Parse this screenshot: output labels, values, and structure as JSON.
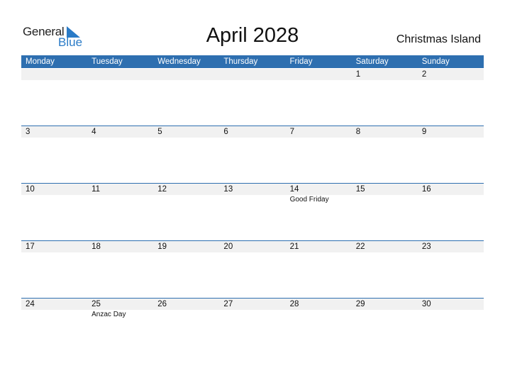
{
  "logo": {
    "text_general": "General",
    "text_blue": "Blue",
    "accent_color": "#2a7bc7"
  },
  "title": "April 2028",
  "country": "Christmas Island",
  "header_color": "#2e6fb0",
  "weekdays": [
    "Monday",
    "Tuesday",
    "Wednesday",
    "Thursday",
    "Friday",
    "Saturday",
    "Sunday"
  ],
  "weeks": [
    [
      {
        "day": ""
      },
      {
        "day": ""
      },
      {
        "day": ""
      },
      {
        "day": ""
      },
      {
        "day": ""
      },
      {
        "day": "1"
      },
      {
        "day": "2"
      }
    ],
    [
      {
        "day": "3"
      },
      {
        "day": "4"
      },
      {
        "day": "5"
      },
      {
        "day": "6"
      },
      {
        "day": "7"
      },
      {
        "day": "8"
      },
      {
        "day": "9"
      }
    ],
    [
      {
        "day": "10"
      },
      {
        "day": "11"
      },
      {
        "day": "12"
      },
      {
        "day": "13"
      },
      {
        "day": "14",
        "event": "Good Friday"
      },
      {
        "day": "15"
      },
      {
        "day": "16"
      }
    ],
    [
      {
        "day": "17"
      },
      {
        "day": "18"
      },
      {
        "day": "19"
      },
      {
        "day": "20"
      },
      {
        "day": "21"
      },
      {
        "day": "22"
      },
      {
        "day": "23"
      }
    ],
    [
      {
        "day": "24"
      },
      {
        "day": "25",
        "event": "Anzac Day"
      },
      {
        "day": "26"
      },
      {
        "day": "27"
      },
      {
        "day": "28"
      },
      {
        "day": "29"
      },
      {
        "day": "30"
      }
    ]
  ]
}
